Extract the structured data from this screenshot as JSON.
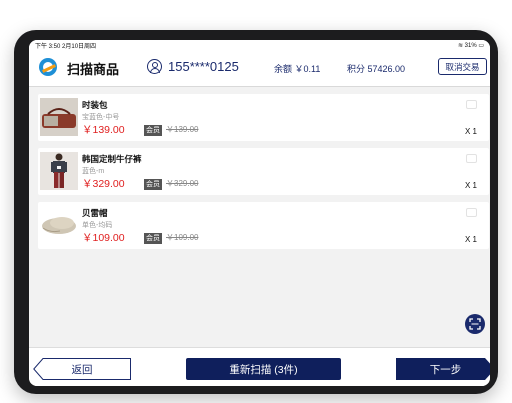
{
  "status_bar": {
    "time": "下午 3:50",
    "date": "2月10日周四",
    "battery": "31%"
  },
  "header": {
    "title": "扫描商品",
    "phone": "155****0125",
    "balance": "余额 ￥0.11",
    "points": "积分 57426.00",
    "cancel_label": "取消交易"
  },
  "products": [
    {
      "name": "时装包",
      "spec": "宝蓝色-中号",
      "price": "￥139.00",
      "vip_badge": "会员",
      "original_price": "￥139.00",
      "quantity": "X 1"
    },
    {
      "name": "韩国定制牛仔裤",
      "spec": "蓝色-m",
      "price": "￥329.00",
      "vip_badge": "会员",
      "original_price": "￥329.00",
      "quantity": "X 1"
    },
    {
      "name": "贝雷帽",
      "spec": "单色-均码",
      "price": "￥109.00",
      "vip_badge": "会员",
      "original_price": "￥109.00",
      "quantity": "X 1"
    }
  ],
  "footer": {
    "back_label": "返回",
    "rescan_label": "重新扫描 (3件)",
    "next_label": "下一步"
  },
  "colors": {
    "navy": "#1a2a6c",
    "button_navy": "#0f1f5c",
    "price_red": "#e02020"
  }
}
